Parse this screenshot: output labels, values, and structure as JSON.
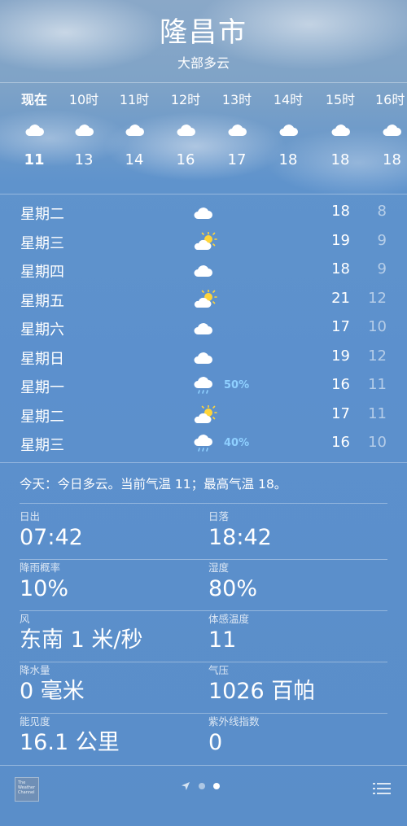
{
  "header": {
    "city": "隆昌市",
    "condition": "大部多云"
  },
  "hourly": [
    {
      "time": "现在",
      "icon": "cloud-icon",
      "temp": "11"
    },
    {
      "time": "10时",
      "icon": "cloud-icon",
      "temp": "13"
    },
    {
      "time": "11时",
      "icon": "cloud-icon",
      "temp": "14"
    },
    {
      "time": "12时",
      "icon": "cloud-icon",
      "temp": "16"
    },
    {
      "time": "13时",
      "icon": "cloud-icon",
      "temp": "17"
    },
    {
      "time": "14时",
      "icon": "cloud-icon",
      "temp": "18"
    },
    {
      "time": "15时",
      "icon": "cloud-icon",
      "temp": "18"
    },
    {
      "time": "16时",
      "icon": "cloud-icon",
      "temp": "18"
    }
  ],
  "daily": [
    {
      "day": "星期二",
      "icon": "cloud-icon",
      "precip": "",
      "high": "18",
      "low": "8"
    },
    {
      "day": "星期三",
      "icon": "partly-sunny-icon",
      "precip": "",
      "high": "19",
      "low": "9"
    },
    {
      "day": "星期四",
      "icon": "cloud-icon",
      "precip": "",
      "high": "18",
      "low": "9"
    },
    {
      "day": "星期五",
      "icon": "partly-sunny-icon",
      "precip": "",
      "high": "21",
      "low": "12"
    },
    {
      "day": "星期六",
      "icon": "cloud-icon",
      "precip": "",
      "high": "17",
      "low": "10"
    },
    {
      "day": "星期日",
      "icon": "cloud-icon",
      "precip": "",
      "high": "19",
      "low": "12"
    },
    {
      "day": "星期一",
      "icon": "rain-icon",
      "precip": "50%",
      "high": "16",
      "low": "11"
    },
    {
      "day": "星期二",
      "icon": "partly-sunny-icon",
      "precip": "",
      "high": "17",
      "low": "11"
    },
    {
      "day": "星期三",
      "icon": "rain-icon",
      "precip": "40%",
      "high": "16",
      "low": "10"
    }
  ],
  "summary": "今天：今日多云。当前气温 11；最高气温 18。",
  "details": [
    {
      "left": {
        "label": "日出",
        "value": "07:42"
      },
      "right": {
        "label": "日落",
        "value": "18:42"
      }
    },
    {
      "left": {
        "label": "降雨概率",
        "value": "10%"
      },
      "right": {
        "label": "湿度",
        "value": "80%"
      }
    },
    {
      "left": {
        "label": "风",
        "value": "东南 1 米/秒"
      },
      "right": {
        "label": "体感温度",
        "value": "11"
      }
    },
    {
      "left": {
        "label": "降水量",
        "value": "0 毫米"
      },
      "right": {
        "label": "气压",
        "value": "1026 百帕"
      }
    },
    {
      "left": {
        "label": "能见度",
        "value": "16.1 公里"
      },
      "right": {
        "label": "紫外线指数",
        "value": "0"
      }
    }
  ],
  "footer": {
    "logo_text": "The Weather Channel",
    "pager_icons": [
      "location-arrow-icon",
      "page-dot",
      "page-dot-active"
    ],
    "list_icon": "list-icon"
  },
  "colors": {
    "precip_text": "#8fd0ff",
    "background": "#5c90cd"
  }
}
